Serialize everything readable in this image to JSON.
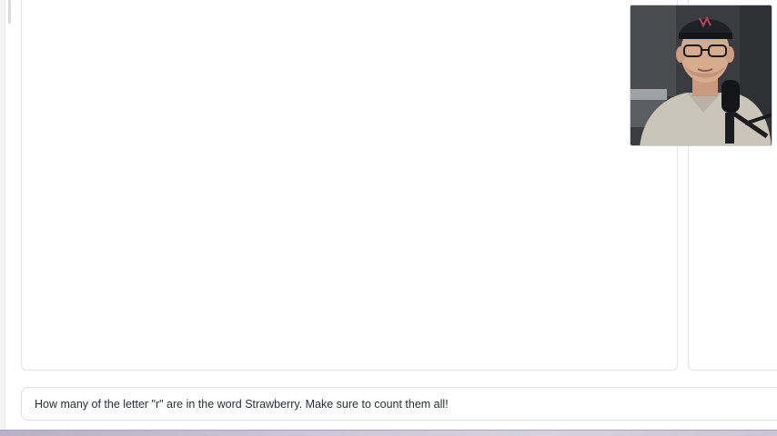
{
  "prompt": {
    "value": "How many of the letter \"r\" are in the word Strawberry. Make sure to count them all!"
  },
  "webcam": {
    "subject": "presenter-with-microphone"
  },
  "colors": {
    "background": "#ffffff",
    "panel_border": "#e3e3e8",
    "prompt_text": "#2a2d33"
  }
}
